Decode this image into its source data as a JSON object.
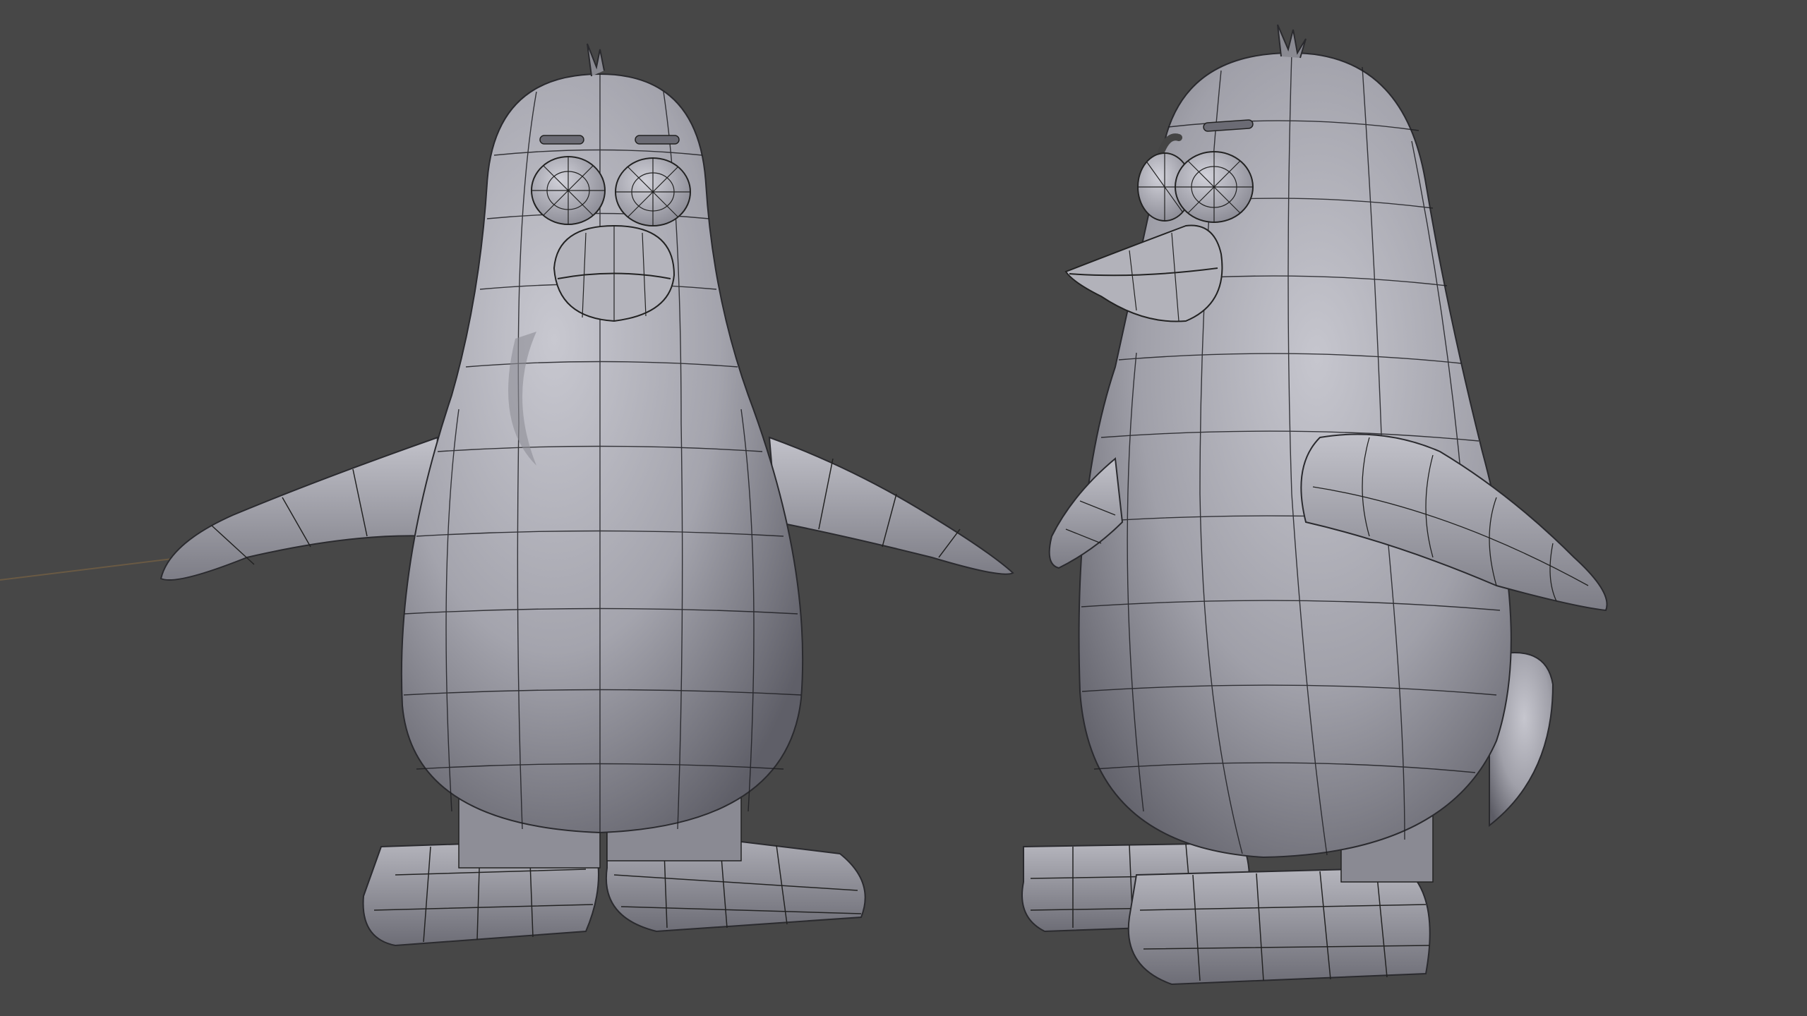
{
  "viewport": {
    "background": "#474747",
    "mode": "3d-viewport-wireframe-overlay",
    "objects": [
      "penguin-front-view",
      "penguin-three-quarter-view"
    ]
  },
  "colors": {
    "surface_light": "#c4c4cc",
    "surface_mid": "#9d9da6",
    "surface_dark": "#5a5a63",
    "wire": "#1e1e22",
    "floor_x_axis": "#6a5a44",
    "floor_y_axis": "#4f6443"
  }
}
